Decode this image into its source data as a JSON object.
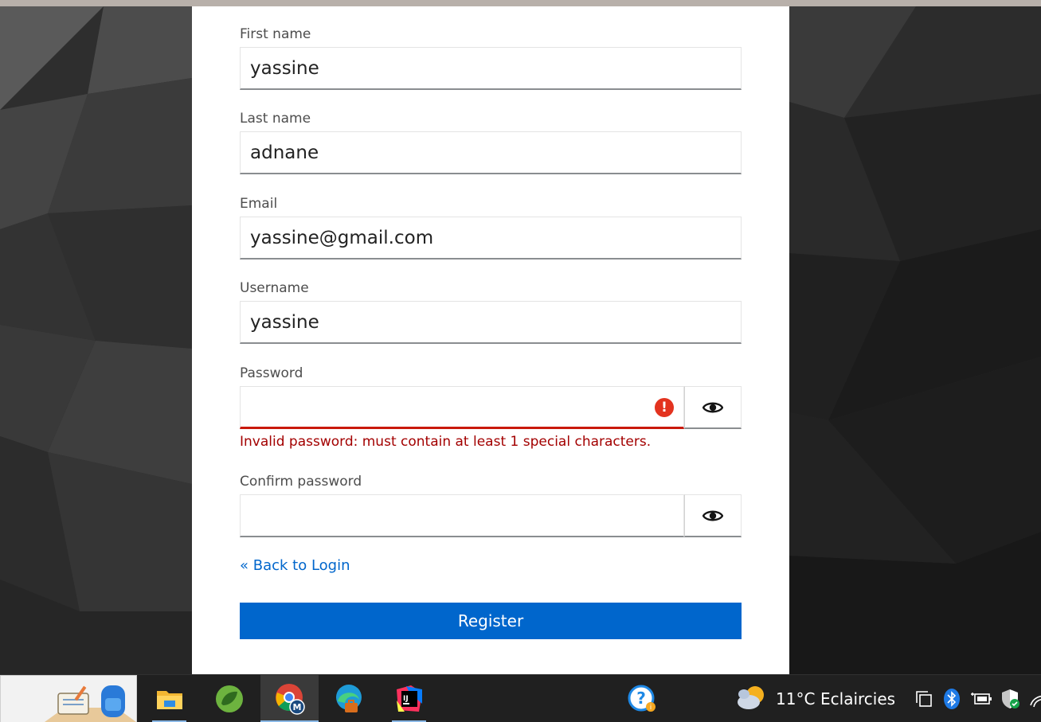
{
  "form": {
    "first_name": {
      "label": "First name",
      "value": "yassine"
    },
    "last_name": {
      "label": "Last name",
      "value": "adnane"
    },
    "email": {
      "label": "Email",
      "value": "yassine@gmail.com"
    },
    "username": {
      "label": "Username",
      "value": "yassine"
    },
    "password": {
      "label": "Password",
      "value": "",
      "error": "Invalid password: must contain at least 1 special characters."
    },
    "confirm_password": {
      "label": "Confirm password",
      "value": ""
    },
    "back_link": "« Back to Login",
    "register_label": "Register"
  },
  "taskbar": {
    "apps": [
      "widgets-app",
      "file-explorer-icon",
      "spring-tools-icon",
      "chrome-icon",
      "edge-icon",
      "intellij-icon"
    ],
    "active_app": "chrome-icon",
    "help_icon": "help-icon",
    "weather": {
      "temperature": "11°C",
      "condition": "Eclaircies"
    },
    "tray_icons": [
      "task-view-icon",
      "bluetooth-icon",
      "battery-icon",
      "security-icon",
      "wifi-icon"
    ]
  },
  "colors": {
    "primary": "#0066cc",
    "error": "#c9190b",
    "error_text": "#a30000",
    "taskbar": "#202020"
  }
}
